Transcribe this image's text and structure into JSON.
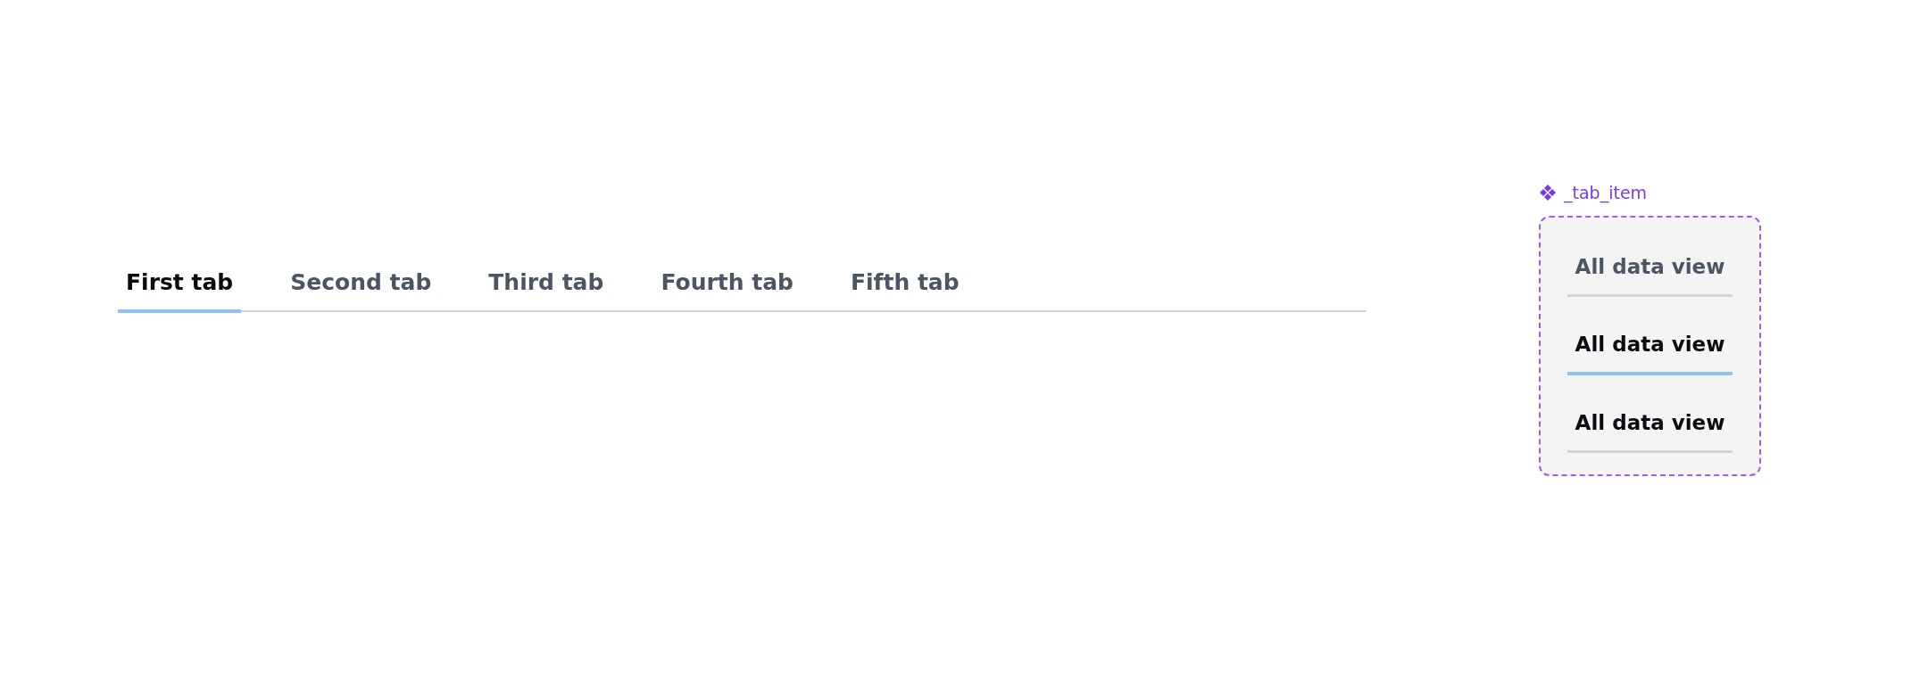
{
  "tabs": [
    {
      "label": "First tab",
      "selected": true
    },
    {
      "label": "Second tab",
      "selected": false
    },
    {
      "label": "Third tab",
      "selected": false
    },
    {
      "label": "Fourth tab",
      "selected": false
    },
    {
      "label": "Fifth tab",
      "selected": false
    }
  ],
  "component": {
    "name": "_tab_item",
    "variants": [
      {
        "label": "All data view",
        "kind": "default"
      },
      {
        "label": "All data view",
        "kind": "selected"
      },
      {
        "label": "All data view",
        "kind": "hover"
      }
    ]
  }
}
